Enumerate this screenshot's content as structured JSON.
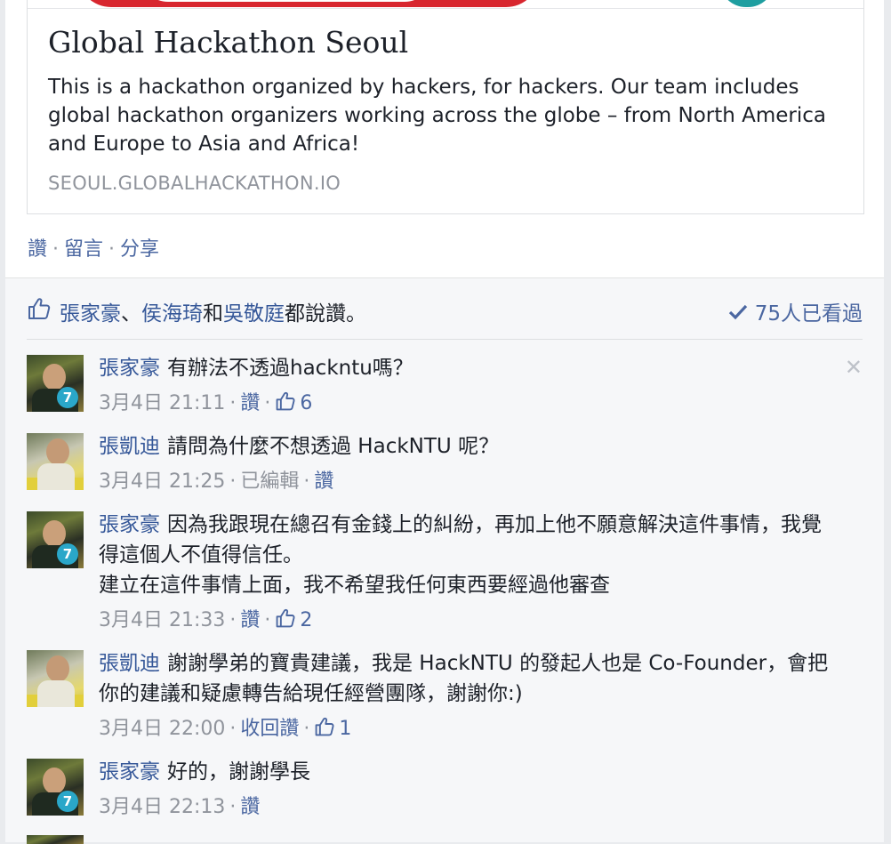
{
  "link_preview": {
    "title": "Global Hackathon Seoul",
    "description": "This is a hackathon organized by hackers, for hackers. Our team includes global hackathon organizers working across the globe – from North America and Europe to Asia and Africa!",
    "url": "SEOUL.GLOBALHACKATHON.IO"
  },
  "post_actions": {
    "like": "讚",
    "comment": "留言",
    "share": "分享",
    "separator": "·"
  },
  "likes": {
    "name1": "張家豪",
    "sep1": "、",
    "name2": "侯海琦",
    "and": "和",
    "name3": "吳敬庭",
    "suffix": "都說讚。",
    "seen": "75人已看過"
  },
  "comments": [
    {
      "author": "張家豪",
      "text": "有辦法不透過hackntu嗎？",
      "time": "3月4日 21:11",
      "action": "讚",
      "like_count": "6",
      "close": "✕"
    },
    {
      "author": "張凱迪",
      "text": "請問為什麼不想透過 HackNTU 呢？",
      "time": "3月4日 21:25",
      "edited": "已編輯",
      "action": "讚"
    },
    {
      "author": "張家豪",
      "text": "因為我跟現在總召有金錢上的糾紛，再加上他不願意解決這件事情，我覺得這個人不值得信任。",
      "text2": "建立在這件事情上面，我不希望我任何東西要經過他審查",
      "time": "3月4日 21:33",
      "action": "讚",
      "like_count": "2"
    },
    {
      "author": "張凱迪",
      "text": "謝謝學弟的寶貴建議，我是 HackNTU 的發起人也是 Co-Founder，會把你的建議和疑慮轉告給現任經營團隊，謝謝你:)",
      "time": "3月4日 22:00",
      "action": "收回讚",
      "like_count": "1"
    },
    {
      "author": "張家豪",
      "text": "好的，謝謝學長",
      "time": "3月4日 22:13",
      "action": "讚"
    }
  ],
  "avatar_badge": "7",
  "colors": {
    "link_blue": "#365899",
    "action_blue": "#4b67a1",
    "meta_gray": "#90949c",
    "ufi_bg": "#f6f7f9"
  }
}
